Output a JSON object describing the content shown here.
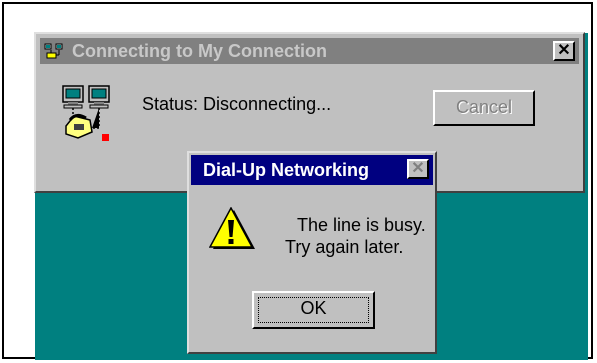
{
  "bg_window": {
    "title": "Connecting to My Connection",
    "close_glyph": "✕",
    "status_text": "Status:  Disconnecting...",
    "cancel_label": "Cancel",
    "icon": "dialup-network-icon"
  },
  "dialog": {
    "title": "Dial-Up Networking",
    "close_glyph": "✕",
    "line1": "The line is busy.",
    "line2": "Try again later.",
    "ok_label": "OK",
    "icon": "warning-icon"
  },
  "colors": {
    "desktop": "#008080",
    "active_titlebar": "#000080",
    "inactive_titlebar": "#808080",
    "face": "#c0c0c0"
  }
}
